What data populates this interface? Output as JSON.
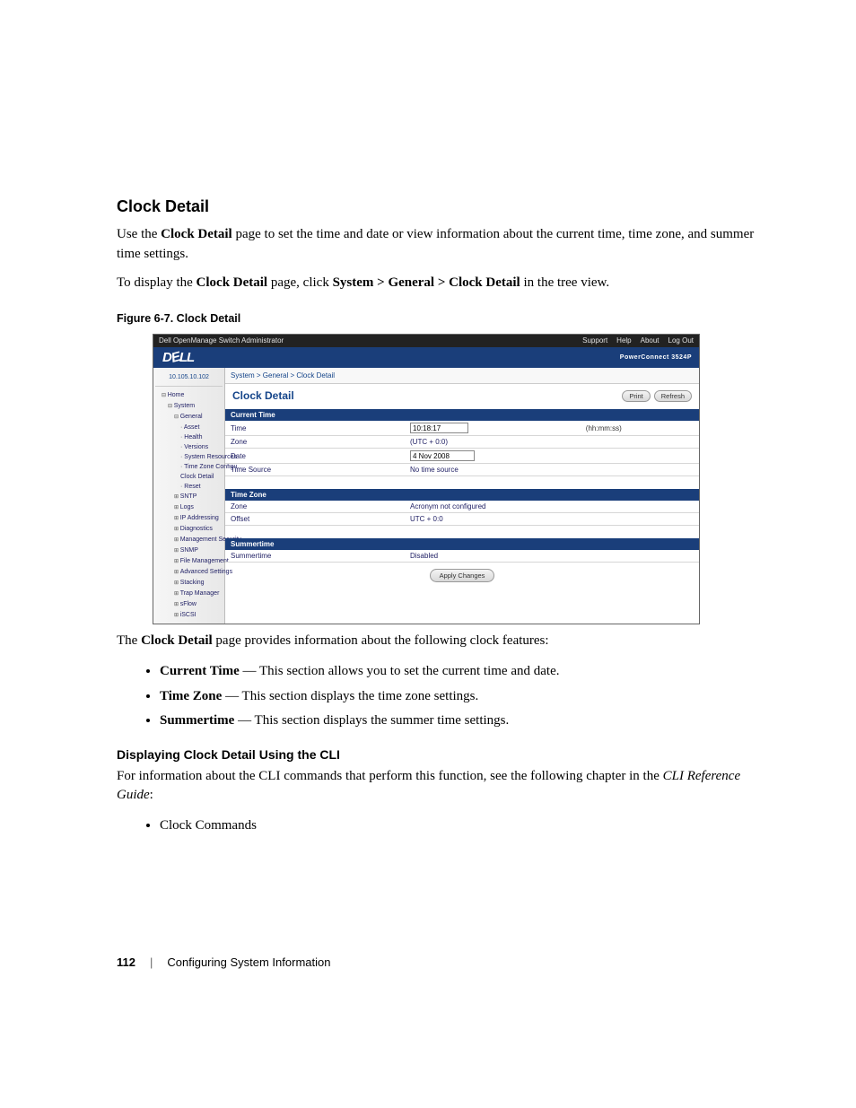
{
  "section_heading": "Clock Detail",
  "intro_p1_a": "Use the ",
  "intro_p1_b": " page to set the time and date or view information about the current time, time zone, and summer time settings.",
  "intro_p2_a": "To display the ",
  "intro_p2_b": " page, click ",
  "intro_p2_c": " in the tree view.",
  "intro_strong1": "Clock Detail",
  "intro_strong2": "Clock Detail",
  "intro_strong3": "System > General > Clock Detail",
  "fig_caption": "Figure 6-7.    Clock Detail",
  "shot": {
    "title": "Dell OpenManage Switch Administrator",
    "top_links": {
      "support": "Support",
      "help": "Help",
      "about": "About",
      "logout": "Log Out"
    },
    "brand": {
      "logo_a": "D",
      "logo_b": "E",
      "logo_c": "LL",
      "model": "PowerConnect 3524P"
    },
    "ip": "10.105.10.102",
    "tree": {
      "home": "Home",
      "system": "System",
      "general": "General",
      "asset": "Asset",
      "health": "Health",
      "versions": "Versions",
      "resources": "System Resources",
      "tzcfg": "Time Zone Configu…",
      "clockdetail": "Clock Detail",
      "reset": "Reset",
      "sntp": "SNTP",
      "logs": "Logs",
      "ipaddr": "IP Addressing",
      "diag": "Diagnostics",
      "msec": "Management Security",
      "snmp": "SNMP",
      "filemgmt": "File Management",
      "adv": "Advanced Settings",
      "stack": "Stacking",
      "trap": "Trap Manager",
      "sflow": "sFlow",
      "iscsi": "iSCSI"
    },
    "crumb": "System > General > Clock Detail",
    "panel_title": "Clock Detail",
    "btn_print": "Print",
    "btn_refresh": "Refresh",
    "sect1": "Current Time",
    "row_time_k": "Time",
    "row_time_v": "10:18:17",
    "row_time_hint": "(hh:mm:ss)",
    "row_zone1_k": "Zone",
    "row_zone1_v": "(UTC + 0:0)",
    "row_date_k": "Date",
    "row_date_v": "4 Nov 2008",
    "row_src_k": "Time Source",
    "row_src_v": "No time source",
    "sect2": "Time Zone",
    "row_zone2_k": "Zone",
    "row_zone2_v": "Acronym not configured",
    "row_off_k": "Offset",
    "row_off_v": "UTC + 0:0",
    "sect3": "Summertime",
    "row_st_k": "Summertime",
    "row_st_v": "Disabled",
    "btn_apply": "Apply Changes"
  },
  "after_p1_a": "The ",
  "after_p1_strong": "Clock Detail",
  "after_p1_b": " page provides information about the following clock features:",
  "bullets1": {
    "b1s": "Current Time",
    "b1t": " — This section allows you to set the current time and date.",
    "b2s": "Time Zone",
    "b2t": " — This section displays the time zone settings.",
    "b3s": "Summertime",
    "b3t": " — This section displays the summer time settings."
  },
  "sub_heading": "Displaying Clock Detail Using the CLI",
  "cli_p_a": "For information about the CLI commands that perform this function, see the following chapter in the ",
  "cli_p_em": "CLI Reference Guide",
  "cli_p_b": ":",
  "bullets2": {
    "b1": "Clock Commands"
  },
  "footer": {
    "page": "112",
    "sep": "|",
    "chapter": "Configuring System Information"
  }
}
